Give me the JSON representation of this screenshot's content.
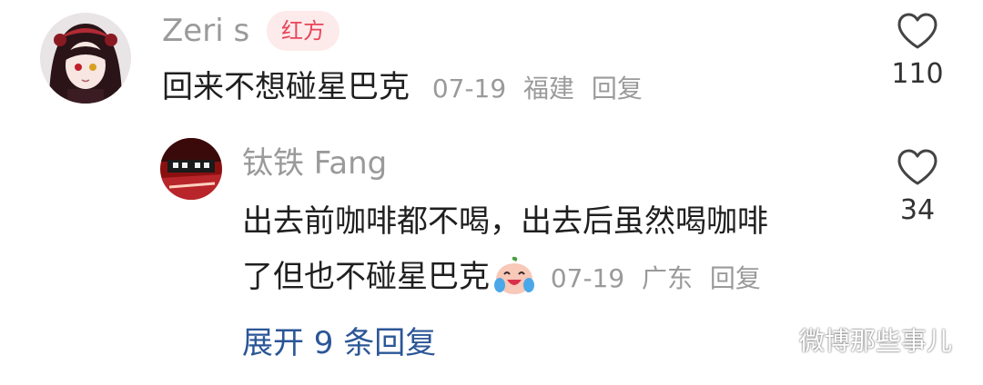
{
  "comments": [
    {
      "user": "Zeri s",
      "badge": "红方",
      "text": "回来不想碰星巴克",
      "date": "07-19",
      "location": "福建",
      "reply_label": "回复",
      "likes": "110"
    }
  ],
  "reply": {
    "user": "钛铁 Fang",
    "text_line1": "出去前咖啡都不喝，出去后虽然喝咖啡",
    "text_line2": "了但也不碰星巴克",
    "emoji_icon": "crying-laughing-face-icon",
    "date": "07-19",
    "location": "广东",
    "reply_label": "回复",
    "likes": "34"
  },
  "expand_label": "展开 9 条回复",
  "watermark": "微博那些事儿",
  "colors": {
    "username": "#9a9a9a",
    "badge_bg": "#fdeaea",
    "badge_text": "#e8455a",
    "link_blue": "#2b5697"
  }
}
